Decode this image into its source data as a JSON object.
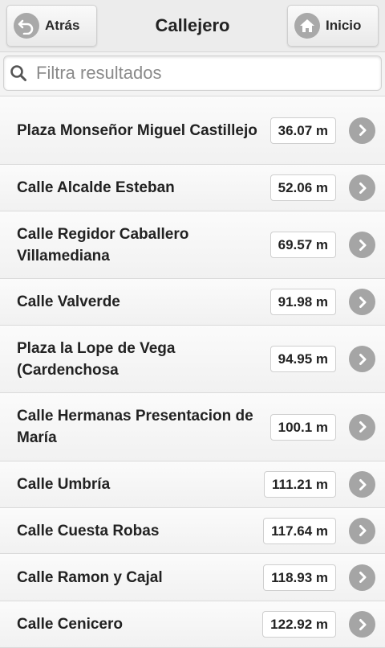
{
  "header": {
    "back_label": "Atrás",
    "title": "Callejero",
    "home_label": "Inicio"
  },
  "search": {
    "placeholder": "Filtra resultados",
    "value": ""
  },
  "rows": [
    {
      "name": "Plaza Monseñor Miguel Castillejo",
      "distance": "36.07 m"
    },
    {
      "name": "Calle Alcalde Esteban",
      "distance": "52.06 m"
    },
    {
      "name": "Calle Regidor Caballero Villamediana",
      "distance": "69.57 m"
    },
    {
      "name": "Calle Valverde",
      "distance": "91.98 m"
    },
    {
      "name": "Plaza la Lope de Vega (Cardenchosa",
      "distance": "94.95 m"
    },
    {
      "name": "Calle Hermanas Presentacion de María",
      "distance": "100.1 m"
    },
    {
      "name": "Calle Umbría",
      "distance": "111.21 m"
    },
    {
      "name": "Calle Cuesta Robas",
      "distance": "117.64 m"
    },
    {
      "name": "Calle Ramon y Cajal",
      "distance": "118.93 m"
    },
    {
      "name": "Calle Cenicero",
      "distance": "122.92 m"
    }
  ]
}
